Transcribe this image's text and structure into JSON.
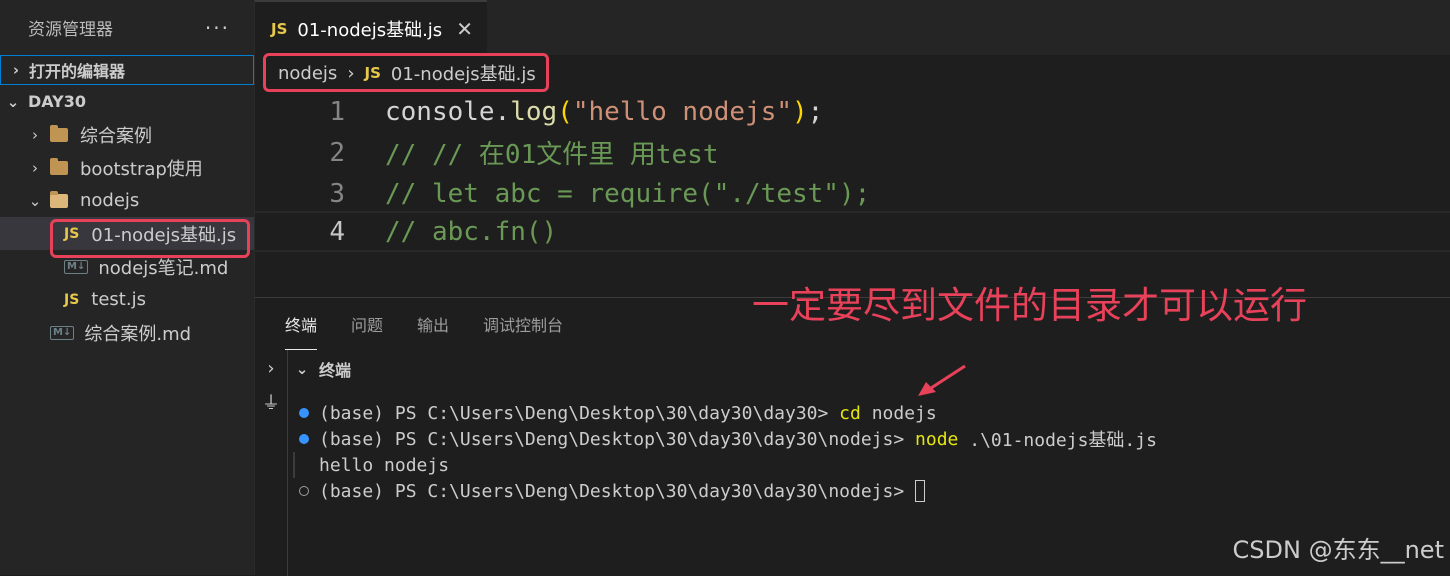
{
  "sidebar": {
    "title": "资源管理器",
    "more": "···",
    "open_editors": "打开的编辑器",
    "root": "DAY30",
    "items": [
      {
        "label": "综合案例",
        "kind": "folder"
      },
      {
        "label": "bootstrap使用",
        "kind": "folder"
      },
      {
        "label": "nodejs",
        "kind": "folder-open"
      },
      {
        "label": "01-nodejs基础.js",
        "kind": "js"
      },
      {
        "label": "nodejs笔记.md",
        "kind": "md"
      },
      {
        "label": "test.js",
        "kind": "js"
      },
      {
        "label": "综合案例.md",
        "kind": "md"
      }
    ]
  },
  "tab": {
    "icon": "JS",
    "label": "01-nodejs基础.js",
    "close": "✕"
  },
  "breadcrumb": {
    "folder": "nodejs",
    "sep": "›",
    "icon": "JS",
    "file": "01-nodejs基础.js"
  },
  "editor": {
    "line_numbers": [
      "1",
      "2",
      "3",
      "4"
    ],
    "line1": {
      "obj": "console",
      "dot": ".",
      "fn": "log",
      "open": "(",
      "str": "\"hello nodejs\"",
      "close": ")",
      "semi": ";"
    },
    "line2": "// // 在01文件里 用test",
    "line3": "// let abc = require(\"./test\");",
    "line4": "// abc.fn()"
  },
  "annotation": "一定要尽到文件的目录才可以运行",
  "panel": {
    "tabs": [
      "终端",
      "问题",
      "输出",
      "调试控制台"
    ],
    "terminal_title": "终端",
    "lines": [
      {
        "prompt": "(base) PS C:\\Users\\Deng\\Desktop\\30\\day30\\day30> ",
        "cmd": "cd",
        "rest": " nodejs"
      },
      {
        "prompt": "(base) PS C:\\Users\\Deng\\Desktop\\30\\day30\\day30\\nodejs> ",
        "cmd": "node",
        "rest": " .\\01-nodejs基础.js"
      },
      {
        "output": "hello nodejs"
      },
      {
        "prompt": "(base) PS C:\\Users\\Deng\\Desktop\\30\\day30\\day30\\nodejs> "
      }
    ]
  },
  "watermark": "CSDN @东东__net",
  "colors": {
    "annotation": "#e8415a",
    "accent": "#007fd4"
  }
}
